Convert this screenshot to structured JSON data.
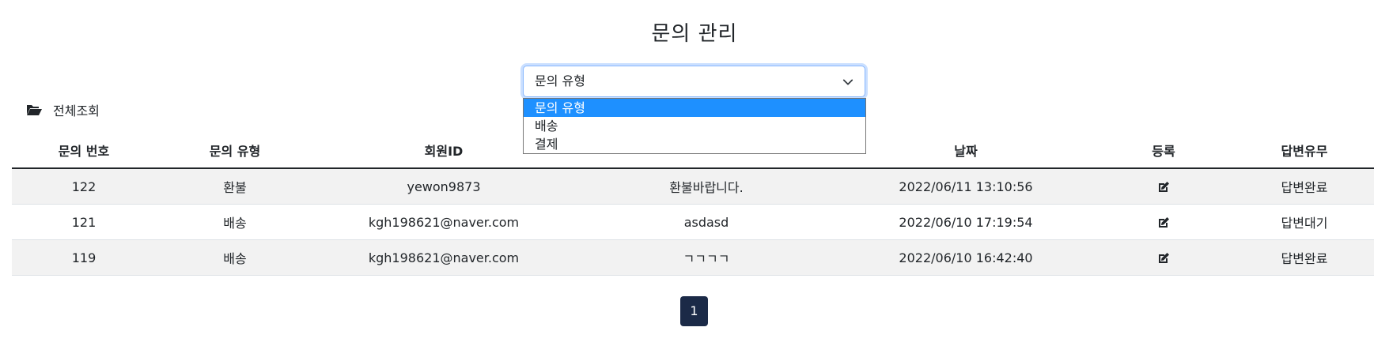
{
  "page": {
    "title": "문의 관리"
  },
  "filter": {
    "selected": "문의 유형",
    "options": [
      "문의 유형",
      "배송",
      "결제"
    ]
  },
  "view_all": {
    "label": "전체조회",
    "icon": "folder-open-icon"
  },
  "table": {
    "headers": [
      "문의 번호",
      "문의 유형",
      "회원ID",
      "",
      "날짜",
      "등록",
      "답변유무"
    ],
    "rows": [
      {
        "no": "122",
        "type": "환불",
        "member": "yewon9873",
        "title": "환불바랍니다.",
        "date": "2022/06/11 13:10:56",
        "edit_icon": "edit-icon",
        "status": "답변완료"
      },
      {
        "no": "121",
        "type": "배송",
        "member": "kgh198621@naver.com",
        "title": "asdasd",
        "date": "2022/06/10 17:19:54",
        "edit_icon": "edit-icon",
        "status": "답변대기"
      },
      {
        "no": "119",
        "type": "배송",
        "member": "kgh198621@naver.com",
        "title": "ㄱㄱㄱㄱ",
        "date": "2022/06/10 16:42:40",
        "edit_icon": "edit-icon",
        "status": "답변완료"
      }
    ]
  },
  "pagination": {
    "current": "1"
  },
  "colors": {
    "dropdown_highlight": "#1e90ff",
    "pager_bg": "#1b2a47",
    "striped_row": "#f2f2f2"
  }
}
